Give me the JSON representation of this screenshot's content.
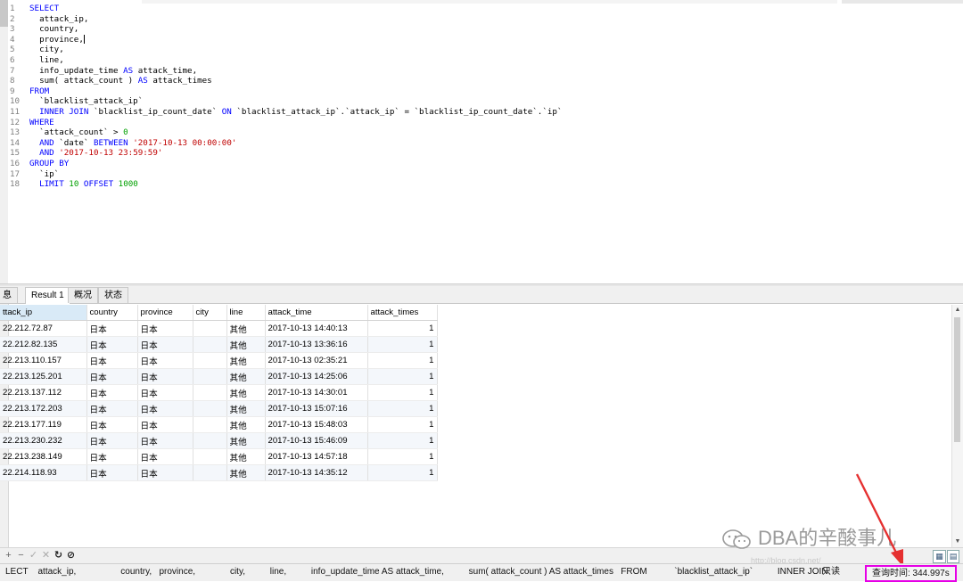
{
  "editor": {
    "lines": [
      {
        "n": "1",
        "segs": [
          {
            "t": "SELECT",
            "c": "kw"
          }
        ]
      },
      {
        "n": "2",
        "segs": [
          {
            "t": "  attack_ip,",
            "c": ""
          }
        ]
      },
      {
        "n": "3",
        "segs": [
          {
            "t": "  country,",
            "c": ""
          }
        ]
      },
      {
        "n": "4",
        "segs": [
          {
            "t": "  province,",
            "c": ""
          }
        ],
        "caret": true
      },
      {
        "n": "5",
        "segs": [
          {
            "t": "  city,",
            "c": ""
          }
        ]
      },
      {
        "n": "6",
        "segs": [
          {
            "t": "  line,",
            "c": ""
          }
        ]
      },
      {
        "n": "7",
        "segs": [
          {
            "t": "  info_update_time ",
            "c": ""
          },
          {
            "t": "AS",
            "c": "kw"
          },
          {
            "t": " attack_time,",
            "c": ""
          }
        ]
      },
      {
        "n": "8",
        "segs": [
          {
            "t": "  sum( attack_count ) ",
            "c": ""
          },
          {
            "t": "AS",
            "c": "kw"
          },
          {
            "t": " attack_times",
            "c": ""
          }
        ]
      },
      {
        "n": "9",
        "segs": [
          {
            "t": "FROM",
            "c": "kw"
          }
        ]
      },
      {
        "n": "10",
        "segs": [
          {
            "t": "  `blacklist_attack_ip`",
            "c": ""
          }
        ]
      },
      {
        "n": "11",
        "segs": [
          {
            "t": "  ",
            "c": ""
          },
          {
            "t": "INNER JOIN",
            "c": "kw"
          },
          {
            "t": " `blacklist_ip_count_date` ",
            "c": ""
          },
          {
            "t": "ON",
            "c": "kw"
          },
          {
            "t": " `blacklist_attack_ip`.`attack_ip` = `blacklist_ip_count_date`.`ip`",
            "c": ""
          }
        ]
      },
      {
        "n": "12",
        "segs": [
          {
            "t": "WHERE",
            "c": "kw"
          }
        ]
      },
      {
        "n": "13",
        "segs": [
          {
            "t": "  `attack_count` > ",
            "c": ""
          },
          {
            "t": "0",
            "c": "num"
          }
        ]
      },
      {
        "n": "14",
        "segs": [
          {
            "t": "  ",
            "c": ""
          },
          {
            "t": "AND",
            "c": "kw"
          },
          {
            "t": " `date` ",
            "c": ""
          },
          {
            "t": "BETWEEN",
            "c": "kw"
          },
          {
            "t": " ",
            "c": ""
          },
          {
            "t": "'2017-10-13 00:00:00'",
            "c": "str"
          }
        ]
      },
      {
        "n": "15",
        "segs": [
          {
            "t": "  ",
            "c": ""
          },
          {
            "t": "AND",
            "c": "kw"
          },
          {
            "t": " ",
            "c": ""
          },
          {
            "t": "'2017-10-13 23:59:59'",
            "c": "str"
          }
        ]
      },
      {
        "n": "16",
        "segs": [
          {
            "t": "GROUP BY",
            "c": "kw"
          }
        ]
      },
      {
        "n": "17",
        "segs": [
          {
            "t": "  `ip`",
            "c": ""
          }
        ]
      },
      {
        "n": "18",
        "segs": [
          {
            "t": "  ",
            "c": ""
          },
          {
            "t": "LIMIT",
            "c": "kw"
          },
          {
            "t": " ",
            "c": ""
          },
          {
            "t": "10",
            "c": "num"
          },
          {
            "t": " ",
            "c": ""
          },
          {
            "t": "OFFSET",
            "c": "kw"
          },
          {
            "t": " ",
            "c": ""
          },
          {
            "t": "1000",
            "c": "num"
          }
        ]
      }
    ]
  },
  "tabs": {
    "info": "息",
    "result": "Result 1",
    "profile": "概况",
    "status": "状态"
  },
  "grid": {
    "headers": [
      "ttack_ip",
      "country",
      "province",
      "city",
      "line",
      "attack_time",
      "attack_times"
    ],
    "rows": [
      [
        "22.212.72.87",
        "日本",
        "日本",
        "",
        "其他",
        "2017-10-13 14:40:13",
        "1"
      ],
      [
        "22.212.82.135",
        "日本",
        "日本",
        "",
        "其他",
        "2017-10-13 13:36:16",
        "1"
      ],
      [
        "22.213.110.157",
        "日本",
        "日本",
        "",
        "其他",
        "2017-10-13 02:35:21",
        "1"
      ],
      [
        "22.213.125.201",
        "日本",
        "日本",
        "",
        "其他",
        "2017-10-13 14:25:06",
        "1"
      ],
      [
        "22.213.137.112",
        "日本",
        "日本",
        "",
        "其他",
        "2017-10-13 14:30:01",
        "1"
      ],
      [
        "22.213.172.203",
        "日本",
        "日本",
        "",
        "其他",
        "2017-10-13 15:07:16",
        "1"
      ],
      [
        "22.213.177.119",
        "日本",
        "日本",
        "",
        "其他",
        "2017-10-13 15:48:03",
        "1"
      ],
      [
        "22.213.230.232",
        "日本",
        "日本",
        "",
        "其他",
        "2017-10-13 15:46:09",
        "1"
      ],
      [
        "22.213.238.149",
        "日本",
        "日本",
        "",
        "其他",
        "2017-10-13 14:57:18",
        "1"
      ],
      [
        "22.214.118.93",
        "日本",
        "日本",
        "",
        "其他",
        "2017-10-13 14:35:12",
        "1"
      ]
    ]
  },
  "gridbar": {
    "add": "+",
    "remove": "−",
    "apply": "✓",
    "discard": "✕",
    "refresh": "↻",
    "stop": "⊘"
  },
  "watermark": {
    "text": "DBA的辛酸事儿",
    "url": "http://blog.csdn.net/"
  },
  "statusbar": {
    "sql": "LECT    attack_ip,                  country,   province,              city,          line,          info_update_time AS attack_time,          sum( attack_count ) AS attack_times   FROM           `blacklist_attack_ip`          INNER JOIN",
    "mode": "只读",
    "query_time": "查询时间: 344.997s"
  },
  "colors": {
    "keyword": "#0000ff",
    "string": "#c00000",
    "number": "#00a000",
    "highlight_box": "#e600e6",
    "arrow": "#e53030"
  }
}
